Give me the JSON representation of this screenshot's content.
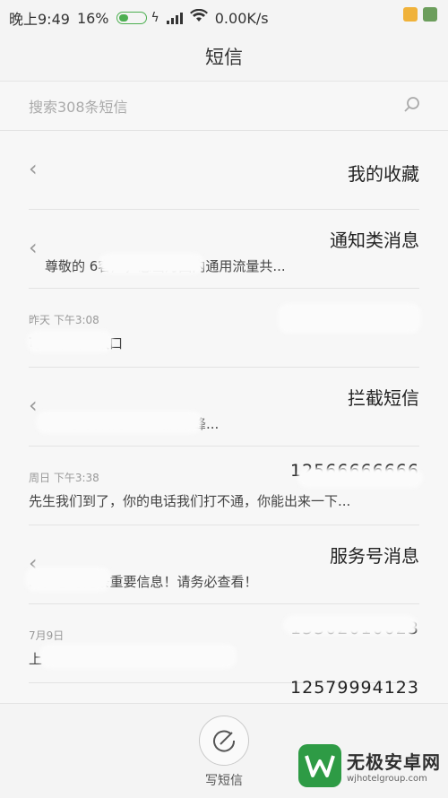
{
  "status": {
    "time": "晚上9:49",
    "battery_percent": "16%",
    "battery_level": 0.16,
    "network_speed": "0.00K/s"
  },
  "header": {
    "title": "短信"
  },
  "search": {
    "placeholder": "搜索308条短信"
  },
  "folders": [
    {
      "title": "我的收藏"
    },
    {
      "title": "通知类消息",
      "preview": "尊敬的                  6客户，您当月国内通用流量共..."
    },
    {
      "title": "拦截短信",
      "preview": "                           里云】首届阿里在线技术峰..."
    },
    {
      "title": "服务号消息",
      "preview": "           Hi，您有两条重要信息！请务必查看！"
    }
  ],
  "messages": [
    {
      "meta": "昨天 下午3:08",
      "sender": "1",
      "preview": "       可以不出地铁口"
    },
    {
      "meta": "周日 下午3:38",
      "sender": "12566666666",
      "preview": "先生我们到了，你的电话我们打不通，你能出来一下..."
    },
    {
      "meta": "7月9日",
      "sender": "13302010023",
      "preview": "上              EGKA"
    },
    {
      "meta": "",
      "sender": "12579994123",
      "preview": ""
    }
  ],
  "bottom": {
    "compose_label": "写短信"
  },
  "watermark": {
    "name": "无极安卓网",
    "url": "wjhotelgroup.com"
  },
  "colors": {
    "accent_green": "#2e9b45",
    "battery_green": "#4caf50"
  }
}
